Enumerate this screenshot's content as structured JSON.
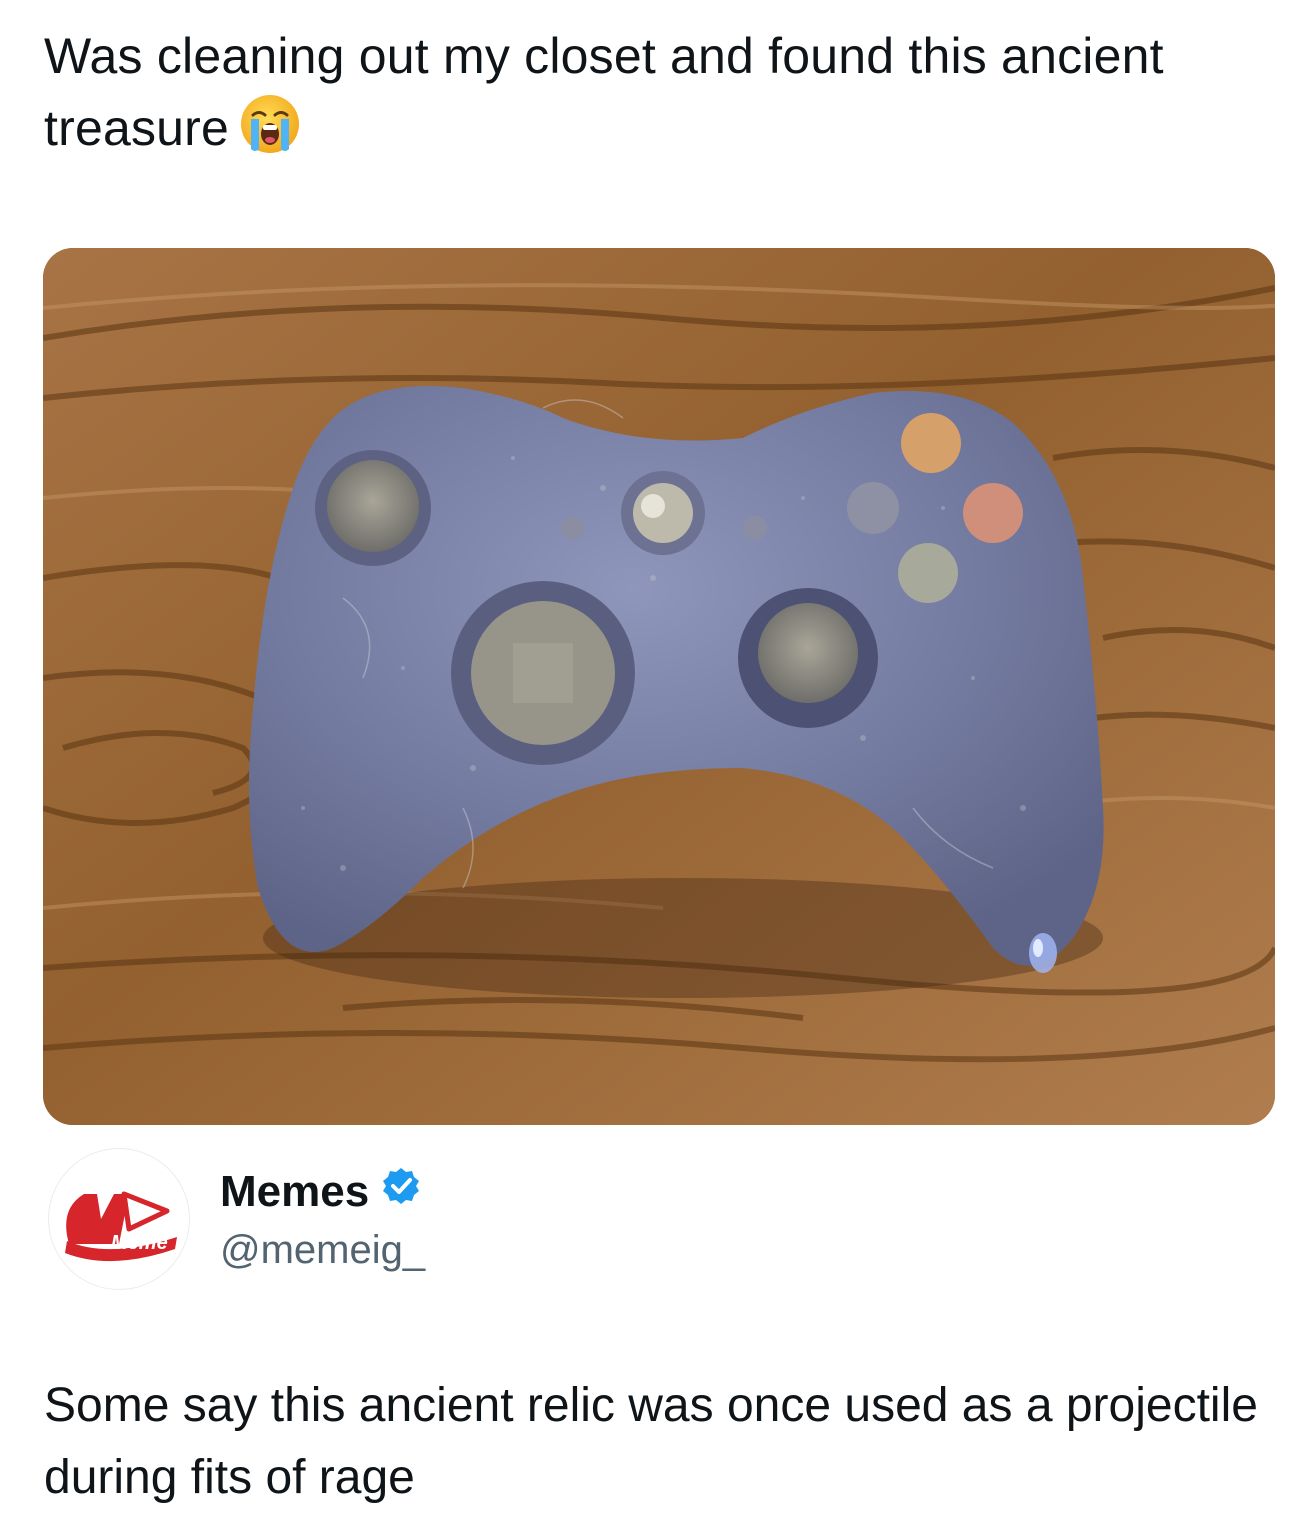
{
  "caption": {
    "text": "Was cleaning out my closet and found this ancient treasure",
    "emoji": "loudly-crying-face-icon"
  },
  "photo": {
    "subject": "dust-covered-game-controller"
  },
  "tweet": {
    "author": {
      "display_name": "Memes",
      "handle": "@memeig_",
      "verified": true,
      "avatar_logo_text": "Meme"
    },
    "text": "Some say this ancient relic was once used as a projectile during fits of rage"
  },
  "colors": {
    "text_primary": "#0f1419",
    "text_secondary": "#536471",
    "verified_blue": "#1d9bf0",
    "brand_red": "#d6262b"
  }
}
